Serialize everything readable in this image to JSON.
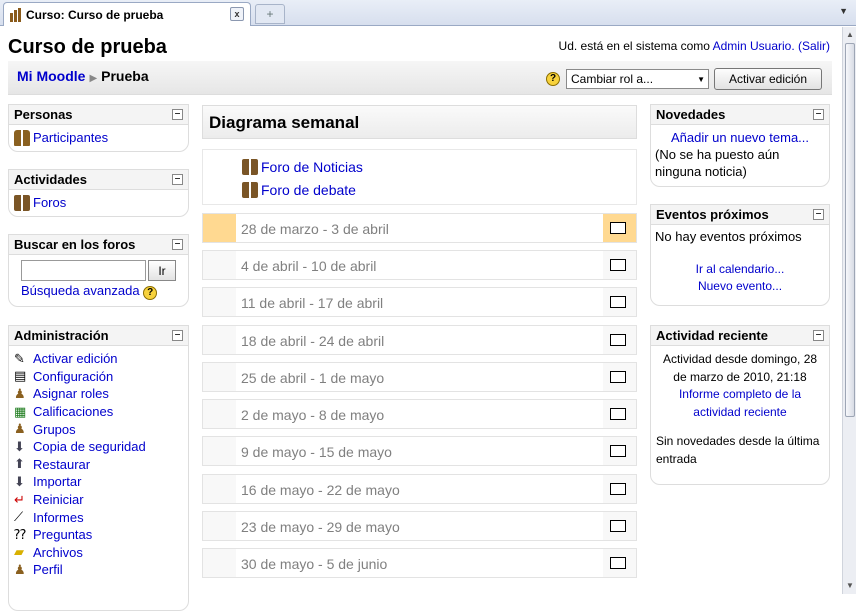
{
  "browser": {
    "tab_title": "Curso: Curso de prueba",
    "new_tab": "+",
    "tab_close": "x"
  },
  "header": {
    "site_title": "Curso de prueba",
    "login_prefix": "Ud. está en el sistema como ",
    "login_user": "Admin Usuario.",
    "logout": "(Salir)"
  },
  "navbar": {
    "crumb_home": "Mi Moodle",
    "crumb_current": "Prueba",
    "role_select_value": "Cambiar rol a...",
    "edit_button": "Activar edición"
  },
  "blocks_left": {
    "personas": {
      "title": "Personas",
      "items": [
        "Participantes"
      ]
    },
    "actividades": {
      "title": "Actividades",
      "items": [
        "Foros"
      ]
    },
    "buscar": {
      "title": "Buscar en los foros",
      "search_value": "",
      "go_button": "Ir",
      "advanced": "Búsqueda avanzada"
    },
    "admin": {
      "title": "Administración",
      "items": [
        "Activar edición",
        "Configuración",
        "Asignar roles",
        "Calificaciones",
        "Grupos",
        "Copia de seguridad",
        "Restaurar",
        "Importar",
        "Reiniciar",
        "Informes",
        "Preguntas",
        "Archivos",
        "Perfil"
      ]
    }
  },
  "main": {
    "weekly_title": "Diagrama semanal",
    "section0_items": [
      "Foro de Noticias",
      "Foro de debate"
    ],
    "weeks": [
      "28 de marzo - 3 de abril",
      "4 de abril - 10 de abril",
      "11 de abril - 17 de abril",
      "18 de abril - 24 de abril",
      "25 de abril - 1 de mayo",
      "2 de mayo - 8 de mayo",
      "9 de mayo - 15 de mayo",
      "16 de mayo - 22 de mayo",
      "23 de mayo - 29 de mayo",
      "30 de mayo - 5 de junio"
    ],
    "current_week_highlight": "#ffd991"
  },
  "blocks_right": {
    "novedades": {
      "title": "Novedades",
      "add_topic": "Añadir un nuevo tema...",
      "no_news": "(No se ha puesto aún ninguna noticia)"
    },
    "eventos": {
      "title": "Eventos próximos",
      "none": "No hay eventos próximos",
      "calendar_link": "Ir al calendario...",
      "new_event": "Nuevo evento..."
    },
    "actividad": {
      "title": "Actividad reciente",
      "since": "Actividad desde domingo, 28 de marzo de 2010, 21:18",
      "full_report": "Informe completo de la actividad reciente",
      "no_news": "Sin novedades desde la última entrada"
    }
  },
  "colors": {
    "link": "#0000cc",
    "week_text": "#808080",
    "accent": "#ffd991"
  }
}
